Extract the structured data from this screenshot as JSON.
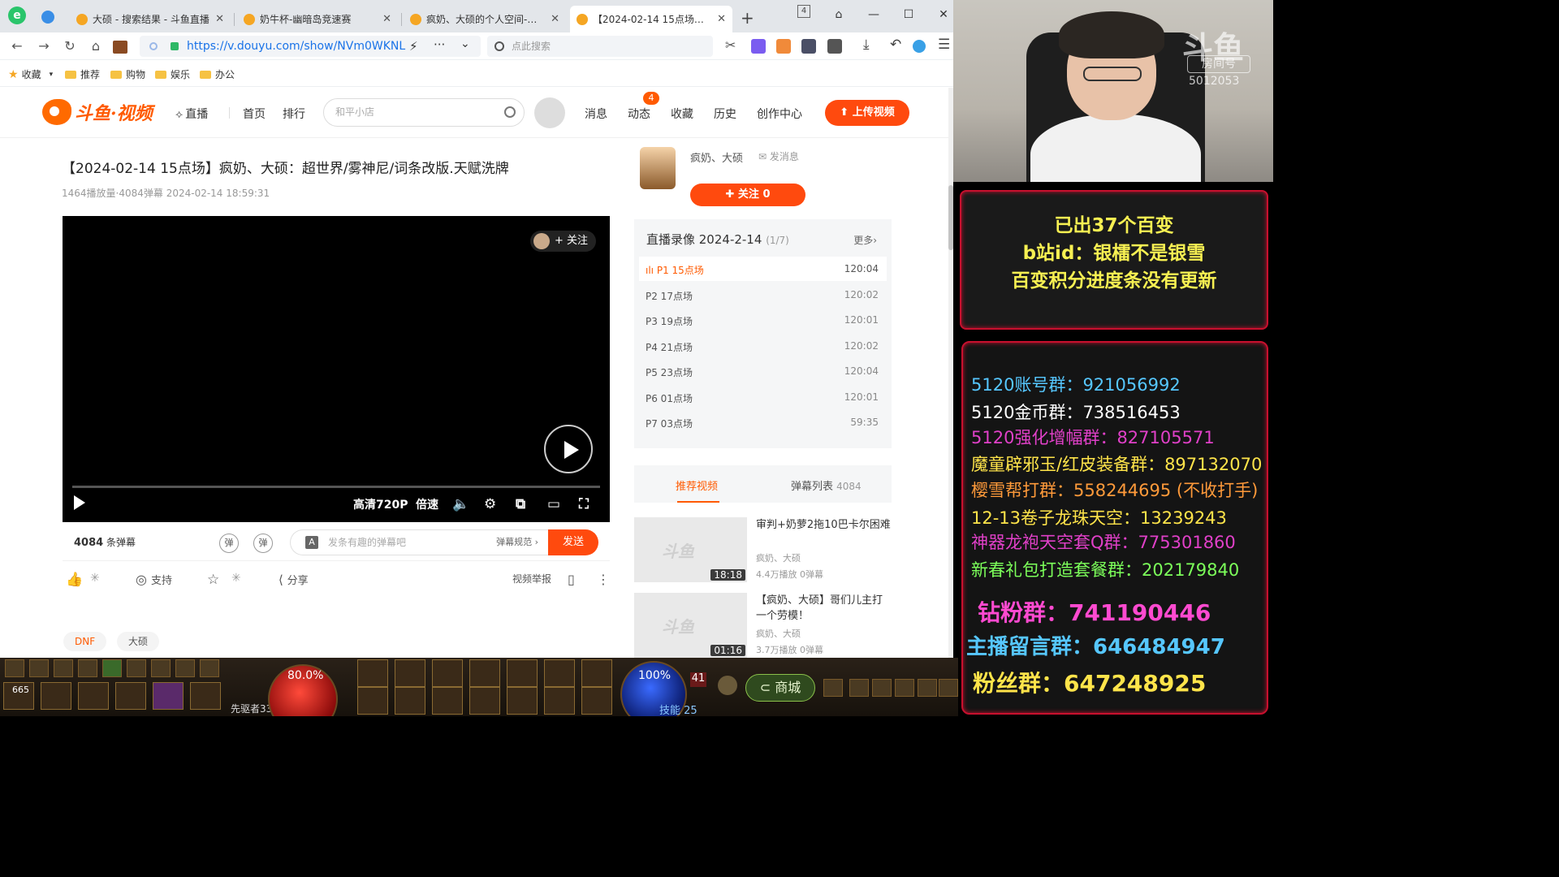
{
  "browser": {
    "tabs": [
      {
        "title": "大硕 - 搜索结果 - 斗鱼直播"
      },
      {
        "title": "奶牛杯-幽暗岛竞速赛"
      },
      {
        "title": "疯奶、大硕的个人空间-斗鱼"
      },
      {
        "title": "【2024-02-14 15点场】疯奶"
      }
    ],
    "tab_count_badge": "4",
    "url": "https://v.douyu.com/show/NVm0WKNL",
    "search_placeholder": "点此搜索",
    "bookmarks": [
      "收藏",
      "推荐",
      "购物",
      "娱乐",
      "办公"
    ]
  },
  "site": {
    "logo_text": "斗鱼·视频",
    "nav": {
      "live": "直播",
      "home": "首页",
      "rank": "排行"
    },
    "search_placeholder": "和平小店",
    "menu": {
      "messages": "消息",
      "dynamic": "动态",
      "dynamic_badge": "4",
      "favorites": "收藏",
      "history": "历史",
      "creator": "创作中心"
    },
    "upload_label": "上传视频"
  },
  "video": {
    "title": "【2024-02-14 15点场】疯奶、大硕：超世界/雾神尼/词条改版.天赋洗牌",
    "meta": "1464播放量·4084弹幕   2024-02-14 18:59:31",
    "follow_pill": "+ 关注",
    "quality": "高清720P",
    "speed": "倍速",
    "danmaku_count": "4084",
    "danmaku_count_unit": "条弹幕",
    "danmaku_placeholder": "发条有趣的弹幕吧",
    "danmaku_rule": "弹幕规范 ›",
    "send_label": "发送",
    "support_label": "支持",
    "share_label": "分享",
    "report_label": "视频举报",
    "tags": [
      "DNF",
      "大硕"
    ]
  },
  "uploader": {
    "name": "疯奶、大硕",
    "message_label": "发消息",
    "follow_label": "关注 0"
  },
  "playlist": {
    "title": "直播录像 2024-2-14",
    "count": "(1/7)",
    "more": "更多›",
    "items": [
      {
        "name": "P1 15点场",
        "duration": "120:04"
      },
      {
        "name": "P2 17点场",
        "duration": "120:02"
      },
      {
        "name": "P3 19点场",
        "duration": "120:01"
      },
      {
        "name": "P4 21点场",
        "duration": "120:02"
      },
      {
        "name": "P5 23点场",
        "duration": "120:04"
      },
      {
        "name": "P6 01点场",
        "duration": "120:01"
      },
      {
        "name": "P7 03点场",
        "duration": "59:35"
      }
    ]
  },
  "right_tabs": {
    "recommend": "推荐视频",
    "danmaku_list": "弹幕列表",
    "danmaku_list_count": "4084"
  },
  "recommendations": [
    {
      "title": "审判+奶萝2拖10巴卡尔困难",
      "author": "疯奶、大硕",
      "stats": "4.4万播放   0弹幕",
      "duration": "18:18"
    },
    {
      "title": "【疯奶、大硕】哥们儿主打一个劳模！",
      "author": "疯奶、大硕",
      "stats": "3.7万播放   0弹幕",
      "duration": "01:16"
    }
  ],
  "stream_overlay": {
    "watermark": "斗鱼",
    "room_label": "房间号",
    "room_id": "5012053",
    "notice_lines": [
      "已出37个百变",
      "b站id：银檑不是银雪",
      "百变积分进度条没有更新"
    ],
    "groups": [
      {
        "text": "5120账号群：921056992",
        "color": "#56c7ff"
      },
      {
        "text": "5120金币群：738516453",
        "color": "#ffffff"
      },
      {
        "text": "5120强化增幅群：827105571",
        "color": "#e040c8"
      },
      {
        "text": "魔童辟邪玉/红皮装备群：897132070",
        "color": "#ffe44a"
      },
      {
        "text": "樱雪帮打群：558244695 (不收打手)",
        "color": "#ff9a3a"
      },
      {
        "text": "12-13卷子龙珠天空：13239243",
        "color": "#ffe44a"
      },
      {
        "text": "神器龙袍天空套Q群：775301860",
        "color": "#e040c8"
      },
      {
        "text": "新春礼包打造套餐群：202179840",
        "color": "#7cff5a"
      },
      {
        "text": "钻粉群：741190446",
        "color": "#ff4ad0"
      },
      {
        "text": "主播留言群：646484947",
        "color": "#56c7ff"
      },
      {
        "text": "粉丝群：647248925",
        "color": "#ffe44a"
      }
    ]
  },
  "game_hud": {
    "hp_percent": "80.0%",
    "mp_percent": "100%",
    "item_count": "665",
    "level_text": "先驱者33",
    "mall_label": "商城",
    "skill_label": "技能",
    "skill_points": "25",
    "level_number": "41"
  }
}
